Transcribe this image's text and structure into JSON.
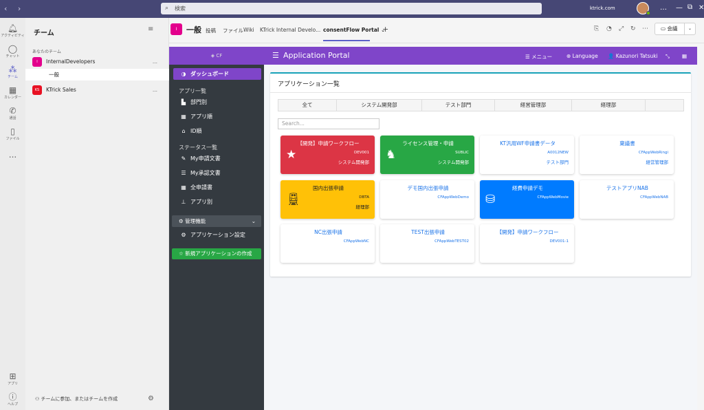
{
  "titlebar": {
    "search_placeholder": "検索",
    "tenant": "ktrick.com",
    "nav": "‹ ›"
  },
  "rail": [
    {
      "label": "アクティビティ",
      "icon": "bell-icon"
    },
    {
      "label": "チャット",
      "icon": "chat-icon"
    },
    {
      "label": "チーム",
      "icon": "teams-icon"
    },
    {
      "label": "カレンダー",
      "icon": "calendar-icon"
    },
    {
      "label": "通話",
      "icon": "phone-icon"
    },
    {
      "label": "ファイル",
      "icon": "file-icon"
    },
    {
      "label": "...",
      "icon": "more-icon"
    },
    {
      "label": "アプリ",
      "icon": "apps-icon"
    },
    {
      "label": "ヘルプ",
      "icon": "help-icon"
    }
  ],
  "teams_panel": {
    "title": "チーム",
    "section": "あなたのチーム",
    "teams": [
      {
        "name": "InternalDevelopers",
        "initial": "I",
        "color": "#e3008c"
      },
      {
        "name": "KTrick Sales",
        "initial": "KS",
        "color": "#e81123"
      }
    ],
    "channel": "一般",
    "join": "チームに参加、またはチームを作成",
    "more": "..."
  },
  "header": {
    "initial": "I",
    "title": "一般",
    "tabs": [
      "投稿",
      "ファイル",
      "Wiki",
      "KTrick Internal Develo...",
      "consentFlow Portal ⌄"
    ],
    "add": "+",
    "meet_label": "会議",
    "meet_dropdown": "⌄"
  },
  "cf": {
    "logo": "CF",
    "app_title": "Application Portal",
    "menu_button": "☰",
    "top_items": [
      "☰ メニュー",
      "⊕ Language",
      "👤 Kazunori Tatsuki",
      "⤡",
      "▦"
    ],
    "dashboard": "ダッシュボード",
    "app_list_head": "アプリ一覧",
    "app_list": [
      "部門別",
      "アプリ順",
      "ID順"
    ],
    "status_head": "ステータス一覧",
    "status_list": [
      "My申請文書",
      "My承認文書",
      "全申請書",
      "アプリ別"
    ],
    "admin": "管理機能",
    "admin_items": [
      "アプリケーション設定"
    ],
    "new_app": "新規アプリケーションの作成",
    "card_title": "アプリケーション一覧",
    "filters": [
      "全て",
      "システム開発部",
      "テスト部門",
      "経営管理部",
      "経理部",
      ""
    ],
    "search_placeholder": "Search...",
    "tiles": [
      {
        "name": "【開発】申請ワークフロー",
        "code": "DEV001",
        "dept": "システム開発部",
        "style": "red",
        "icon": "star-icon"
      },
      {
        "name": "ライセンス管理・申請",
        "code": "SUBLIC",
        "dept": "システム開発部",
        "style": "green",
        "icon": "chess-knight-icon"
      },
      {
        "name": "KT汎用WF申請書データ",
        "code": "A0012NEW",
        "dept": "テスト部門",
        "style": "white",
        "icon": ""
      },
      {
        "name": "稟議書",
        "code": "CFAppWebRingi",
        "dept": "経営管理部",
        "style": "white",
        "icon": ""
      },
      {
        "name": "国内出張申請",
        "code": "DBTA",
        "dept": "経理部",
        "style": "yellow",
        "icon": "train-icon"
      },
      {
        "name": "デモ国内出張申請",
        "code": "CFAppWebDemo",
        "dept": "",
        "style": "white",
        "icon": ""
      },
      {
        "name": "経費申請デモ",
        "code": "CFAppWebMovie",
        "dept": "",
        "style": "blue",
        "icon": "coins-icon"
      },
      {
        "name": "テストアプリNAB",
        "code": "CFAppWebNAB",
        "dept": "",
        "style": "white",
        "icon": ""
      },
      {
        "name": "NC出張申請",
        "code": "CFAppWebNC",
        "dept": "",
        "style": "white",
        "icon": ""
      },
      {
        "name": "TEST出張申請",
        "code": "CFAppWebTEST02",
        "dept": "",
        "style": "white",
        "icon": ""
      },
      {
        "name": "【開発】申請ワークフロー",
        "code": "DEV001-1",
        "dept": "",
        "style": "white",
        "icon": ""
      }
    ]
  }
}
